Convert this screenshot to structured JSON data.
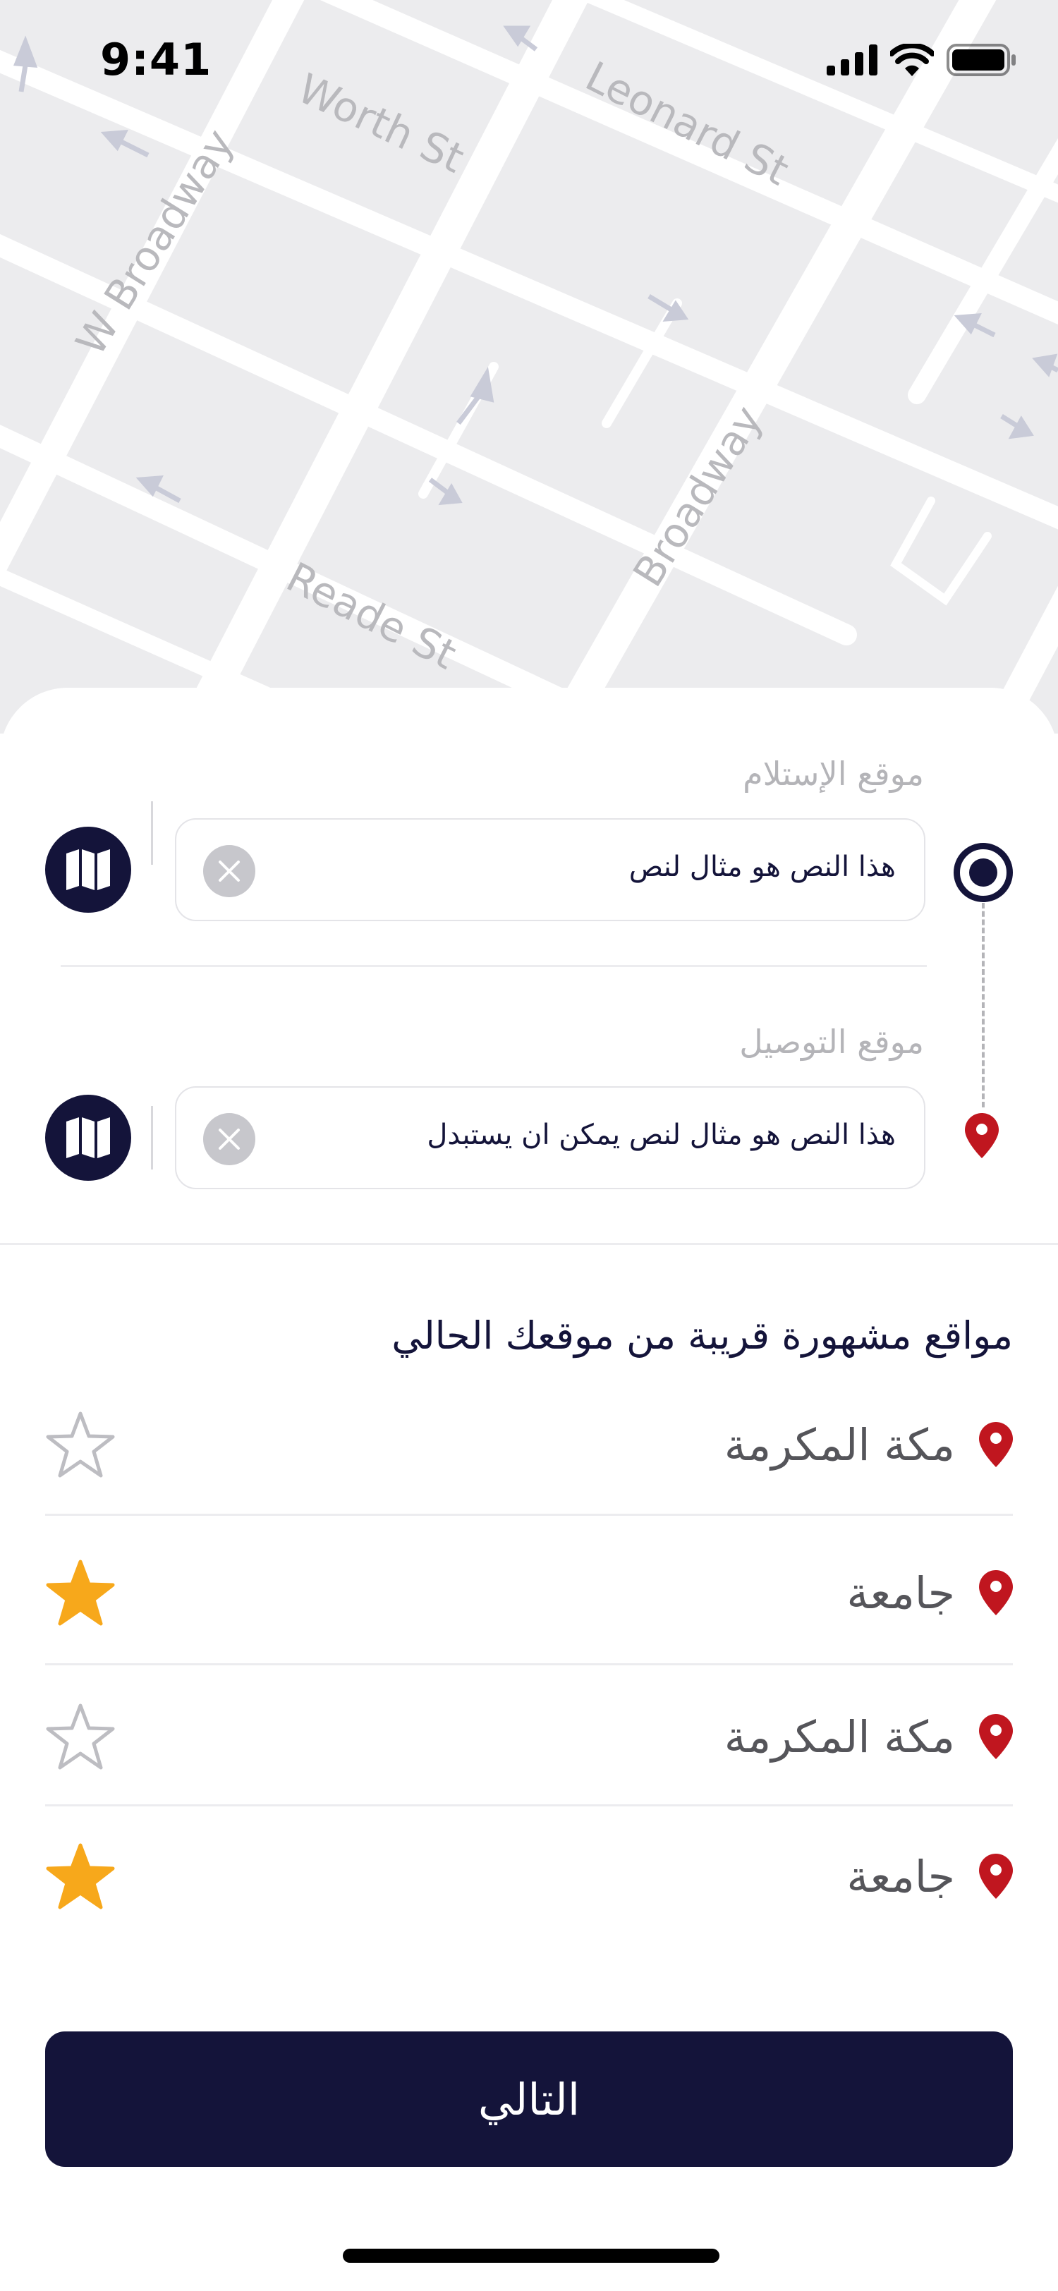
{
  "status_bar": {
    "time": "9:41"
  },
  "map": {
    "streets": [
      "Worth St",
      "Leonard St",
      "W Broadway",
      "Broadway",
      "Reade St"
    ]
  },
  "pickup": {
    "label": "موقع الإستلام",
    "value": "هذا النص هو مثال لنص"
  },
  "dropoff": {
    "label": "موقع التوصيل",
    "value": "هذا النص هو مثال لنص يمكن ان يستبدل"
  },
  "nearby": {
    "title": "مواقع مشهورة قريبة من موقعك الحالي",
    "places": [
      {
        "name": "مكة المكرمة",
        "favorite": false
      },
      {
        "name": "جامعة",
        "favorite": true
      },
      {
        "name": "مكة المكرمة",
        "favorite": false
      },
      {
        "name": "جامعة",
        "favorite": true
      }
    ]
  },
  "next_button": {
    "label": "التالي"
  },
  "colors": {
    "primary": "#14143a",
    "pin": "#c0161f",
    "star_active": "#f7a81b",
    "star_inactive": "#bdbdc2"
  },
  "icons": {
    "map_button": "map-icon",
    "clear": "close-icon",
    "pin": "location-pin-icon",
    "favorite": "star-icon"
  }
}
